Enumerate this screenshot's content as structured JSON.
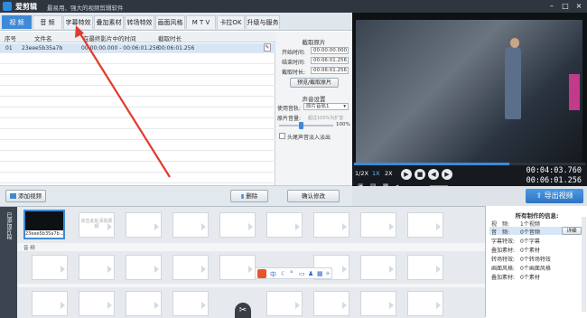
{
  "window": {
    "app_title": "爱剪辑",
    "slogan": "最易用、强大的视频剪辑软件",
    "controls": [
      "–",
      "□",
      "×"
    ]
  },
  "tabs": [
    {
      "label": "视 频",
      "active": true
    },
    {
      "label": "音 频",
      "active": false
    },
    {
      "label": "字幕特效",
      "active": false
    },
    {
      "label": "叠加素材",
      "active": false
    },
    {
      "label": "转场特效",
      "active": false
    },
    {
      "label": "画面风格",
      "active": false
    },
    {
      "label": "M T V",
      "active": false
    },
    {
      "label": "卡拉OK",
      "active": false
    },
    {
      "label": "升级与服务",
      "active": false
    }
  ],
  "clip_table": {
    "headers": [
      "序号",
      "文件名",
      "在最终影片中的时间",
      "截取时长"
    ],
    "rows": [
      {
        "index": "01",
        "file": "23eee5b35a7b",
        "time": "00:00:00.000 - 00:06:01.256",
        "duration": "00:06:01.256",
        "selected": true
      }
    ],
    "row_edit_icon": "✎"
  },
  "trim_panel": {
    "section_title": "截取原片",
    "start_label": "开始时间:",
    "start_value": "00:00:00.000",
    "end_label": "结束时间:",
    "end_value": "00:06:01.256",
    "duration_label": "截取时长:",
    "duration_value": "00:06:01.256",
    "preview_button": "预览/截取原片",
    "audio_section_title": "声音设置",
    "track_label": "使用音轨:",
    "track_value": "原片音轨1",
    "volume_label": "原片音量:",
    "volume_note": "超过100%为扩音",
    "volume_value": "100%",
    "fade_label": "头尾声音淡入淡出",
    "confirm_button": "确认修改"
  },
  "bottom_buttons": {
    "add_video": "添加视频",
    "delete": "删除"
  },
  "player": {
    "speed_options": [
      "1/2X",
      "1X",
      "2X"
    ],
    "current_time": "00:04:03.760",
    "total_time": "00:06:01.256",
    "progress_fraction": 0.67,
    "export_button": "导出视频"
  },
  "timeline": {
    "side_label": "已添加片段",
    "clip_name": "23eee5b35a7b...",
    "add_hint": "双击此处添加视频",
    "audio_track_label": "音 频",
    "scissors_icon": "✂"
  },
  "info_panel": {
    "title": "所有制作的信息:",
    "items": [
      {
        "label": "视　频:",
        "value": "1个视频"
      },
      {
        "label": "音　频:",
        "value": "0个音频"
      },
      {
        "label": "字幕特效:",
        "value": "0个字幕"
      },
      {
        "label": "叠加素材:",
        "value": "0个素材"
      },
      {
        "label": "转场特效:",
        "value": "0个转场特效"
      },
      {
        "label": "画面风格:",
        "value": "0个画面风格"
      },
      {
        "label": "叠加素材:",
        "value": "0个素材"
      }
    ],
    "detail_button": "详细"
  },
  "colors": {
    "accent": "#3f8ad6",
    "dark": "#2f3640",
    "annotation_arrow": "#e23b2e"
  }
}
